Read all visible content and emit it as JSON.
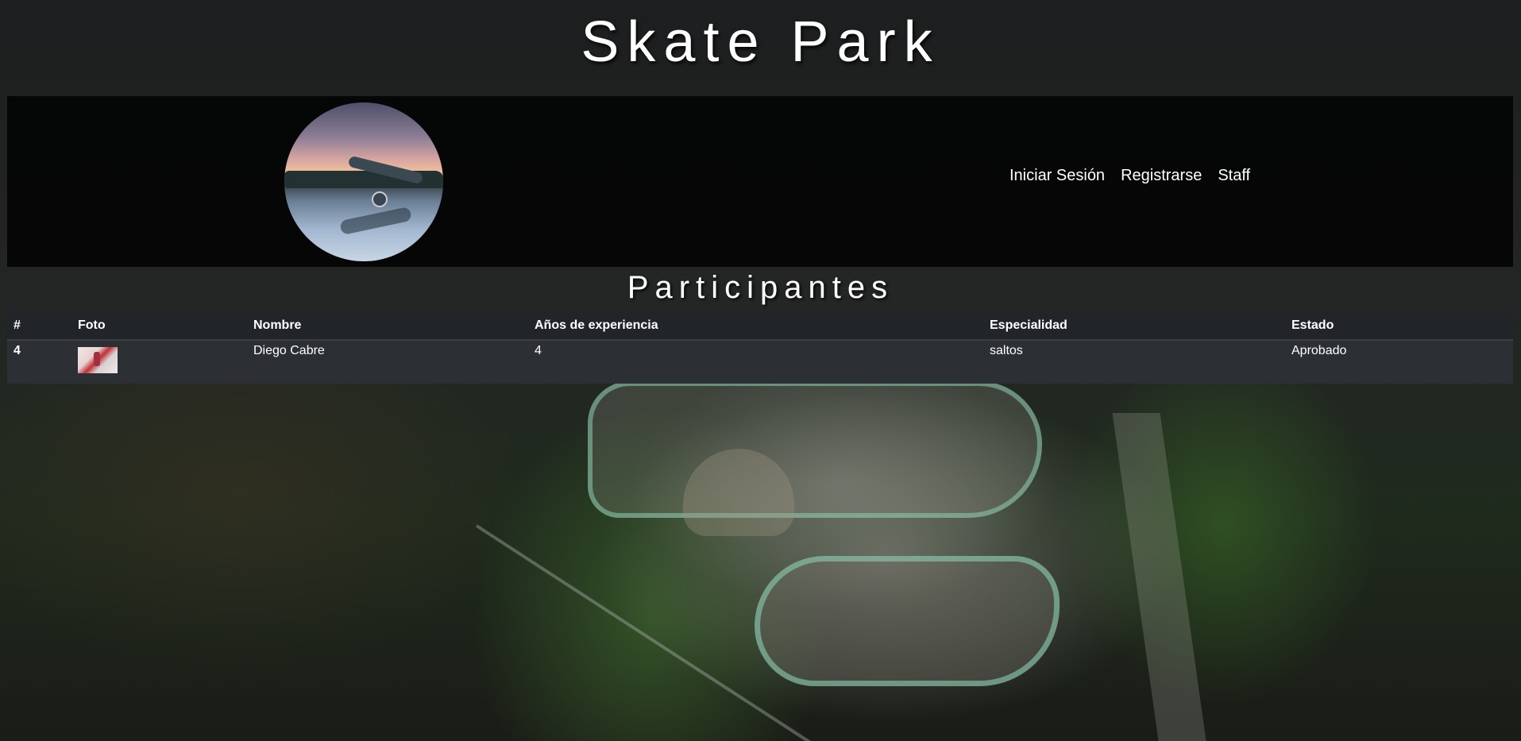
{
  "site": {
    "title": "Skate Park"
  },
  "nav": {
    "items": [
      {
        "label": "Iniciar Sesión"
      },
      {
        "label": "Registrarse"
      },
      {
        "label": "Staff"
      }
    ]
  },
  "main": {
    "section_title": "Participantes",
    "table": {
      "headers": [
        "#",
        "Foto",
        "Nombre",
        "Años de experiencia",
        "Especialidad",
        "Estado"
      ],
      "rows": [
        {
          "num": "4",
          "photo_icon": "participant-photo",
          "name": "Diego Cabre",
          "experience": "4",
          "specialty": "saltos",
          "status": "Aprobado"
        }
      ]
    }
  }
}
